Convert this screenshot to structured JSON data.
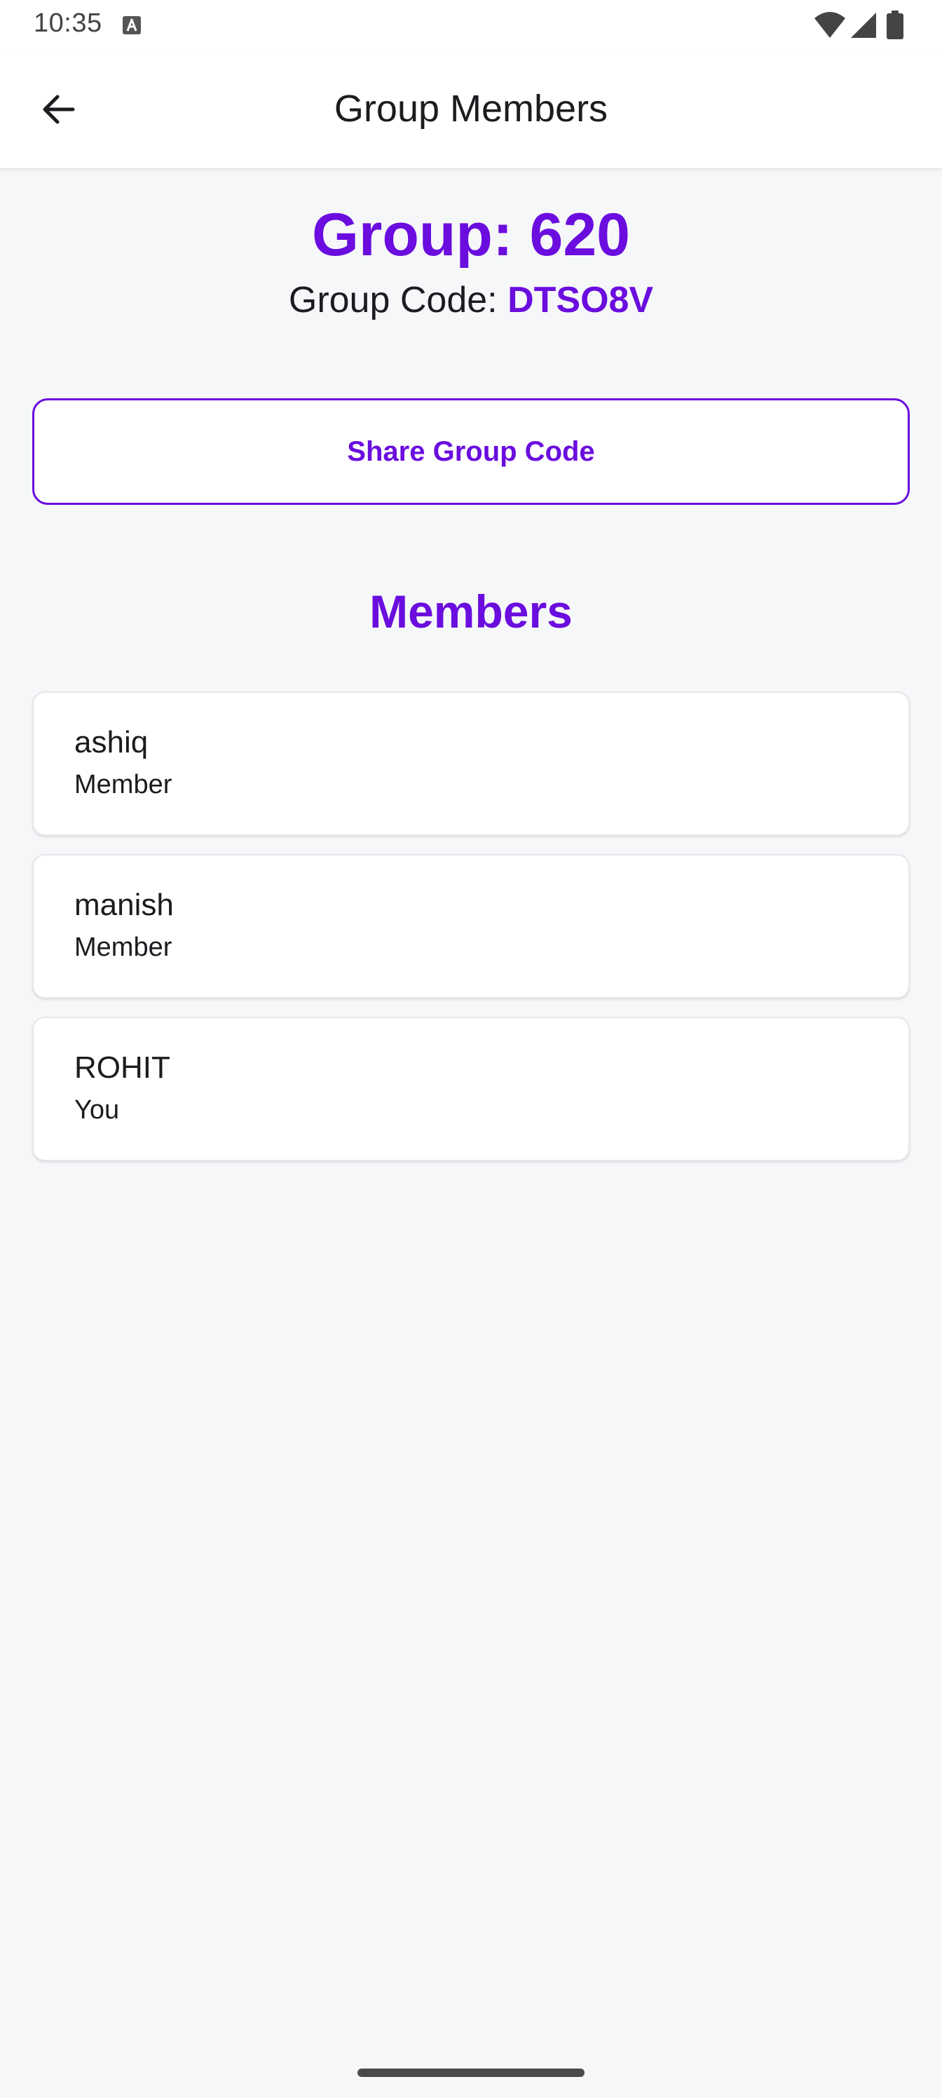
{
  "status_bar": {
    "time": "10:35",
    "left_icon": "text-a-icon",
    "right_icons": [
      "wifi-icon",
      "cell-signal-icon",
      "battery-icon"
    ]
  },
  "app_bar": {
    "title": "Group Members",
    "back_icon": "arrow-left-icon"
  },
  "group": {
    "title": "Group: 620",
    "code_label": "Group Code: ",
    "code_value": "DTSO8V"
  },
  "share_button": {
    "label": "Share Group Code"
  },
  "members": {
    "heading": "Members",
    "items": [
      {
        "name": "ashiq",
        "role": "Member"
      },
      {
        "name": "manish",
        "role": "Member"
      },
      {
        "name": "ROHIT",
        "role": "You"
      }
    ]
  },
  "colors": {
    "accent": "#6a0dde",
    "background": "#f6f7f9",
    "surface": "#ffffff",
    "text": "#1c1b1f"
  }
}
